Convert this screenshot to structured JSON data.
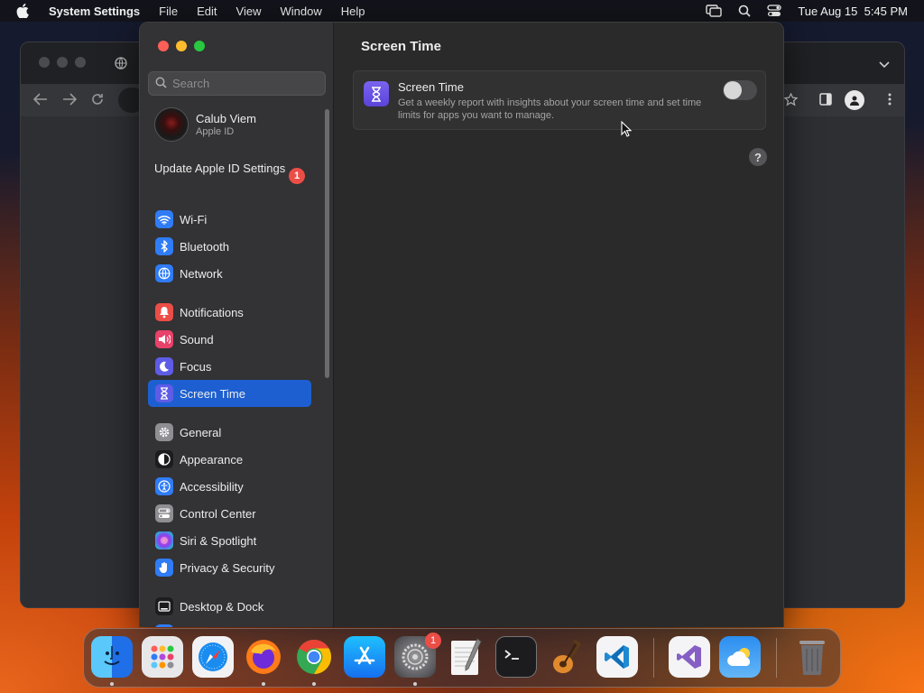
{
  "menubar": {
    "app_name": "System Settings",
    "menus": [
      "File",
      "Edit",
      "View",
      "Window",
      "Help"
    ],
    "datetime": "Tue Aug 15  5:45 PM"
  },
  "sidebar": {
    "search_placeholder": "Search",
    "account": {
      "name": "Calub Viem",
      "subtitle": "Apple ID"
    },
    "update_label": "Update Apple ID Settings",
    "update_badge": "1",
    "items": [
      {
        "label": "Wi-Fi",
        "icon": "wifi-icon",
        "color": "#2f7cf6"
      },
      {
        "label": "Bluetooth",
        "icon": "bluetooth-icon",
        "color": "#2f7cf6"
      },
      {
        "label": "Network",
        "icon": "globe-icon",
        "color": "#2f7cf6"
      },
      {
        "label": "Notifications",
        "icon": "bell-icon",
        "color": "#eb4d47"
      },
      {
        "label": "Sound",
        "icon": "speaker-icon",
        "color": "#e8426a"
      },
      {
        "label": "Focus",
        "icon": "moon-icon",
        "color": "#5e5ce6"
      },
      {
        "label": "Screen Time",
        "icon": "hourglass-icon",
        "color": "#5e5ce6",
        "selected": true
      },
      {
        "label": "General",
        "icon": "gear-icon",
        "color": "#8e8e93"
      },
      {
        "label": "Appearance",
        "icon": "appearance-icon",
        "color": "#1c1c1e"
      },
      {
        "label": "Accessibility",
        "icon": "accessibility-icon",
        "color": "#2f7cf6"
      },
      {
        "label": "Control Center",
        "icon": "control-center-icon",
        "color": "#8e8e93"
      },
      {
        "label": "Siri & Spotlight",
        "icon": "siri-icon",
        "color": "#b04ad8"
      },
      {
        "label": "Privacy & Security",
        "icon": "hand-icon",
        "color": "#2f7cf6"
      },
      {
        "label": "Desktop & Dock",
        "icon": "dock-icon",
        "color": "#1c1c1e"
      }
    ]
  },
  "main": {
    "title": "Screen Time",
    "card": {
      "title": "Screen Time",
      "description": "Get a weekly report with insights about your screen time and set time limits for apps you want to manage.",
      "toggle_on": false
    },
    "help_label": "?"
  },
  "dock": {
    "apps": [
      "Finder",
      "Launchpad",
      "Safari",
      "Firefox",
      "Chrome",
      "App Store",
      "System Settings",
      "TextEdit",
      "Terminal",
      "GarageBand",
      "Visual Studio Code",
      "Visual Studio",
      "Weather",
      "Trash"
    ],
    "settings_badge": "1"
  }
}
